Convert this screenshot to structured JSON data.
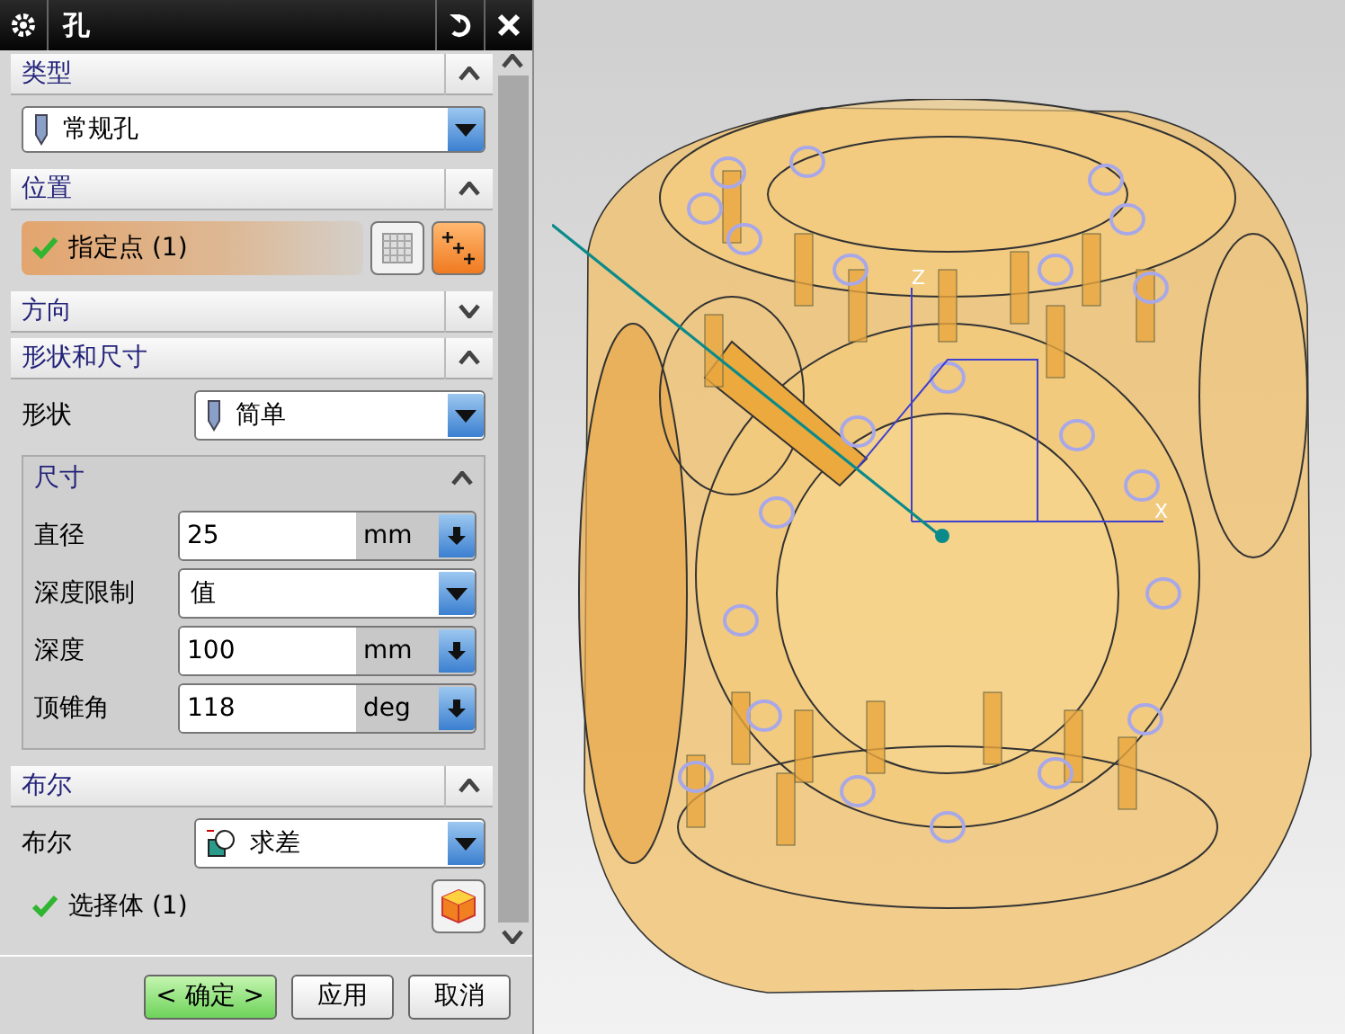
{
  "window": {
    "title": "孔"
  },
  "sections": [
    {
      "kind": "type",
      "title": "类型",
      "expanded": true,
      "value": "常规孔"
    },
    {
      "kind": "position",
      "title": "位置",
      "expanded": true,
      "point": {
        "label": "指定点 (1)",
        "done": true,
        "selected": true
      }
    },
    {
      "title": "方向",
      "expanded": false
    },
    {
      "kind": "shape",
      "title": "形状和尺寸",
      "expanded": true,
      "shape_label": "形状",
      "shape_value": "简单",
      "group": {
        "title": "尺寸",
        "expanded": true,
        "rows": [
          {
            "kind": "unit",
            "label": "直径",
            "value": "25",
            "unit": "mm"
          },
          {
            "kind": "select",
            "label": "深度限制",
            "value": "值"
          },
          {
            "kind": "unit",
            "label": "深度",
            "value": "100",
            "unit": "mm"
          },
          {
            "kind": "unit",
            "label": "顶锥角",
            "value": "118",
            "unit": "deg"
          }
        ]
      }
    },
    {
      "kind": "boolean",
      "title": "布尔",
      "expanded": true,
      "bool_label": "布尔",
      "bool_value": "求差",
      "body": {
        "label": "选择体 (1)",
        "done": true
      }
    }
  ],
  "buttons": [
    {
      "label": "< 确定 >",
      "kind": "primary"
    },
    {
      "label": "应用",
      "kind": "normal"
    },
    {
      "label": "取消",
      "kind": "normal"
    }
  ],
  "viewport": {
    "axis_labels": [
      "Z",
      "X"
    ]
  }
}
